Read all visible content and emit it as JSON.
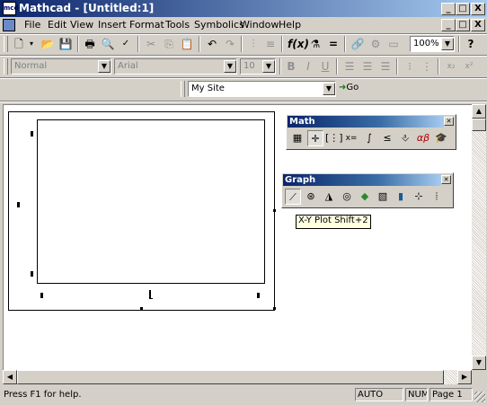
{
  "window": {
    "title": "Mathcad - [Untitled:1]"
  },
  "caption_buttons": {
    "minimize": "_",
    "maximize": "□",
    "close": "X"
  },
  "menu": [
    "File",
    "Edit",
    "View",
    "Insert",
    "Format",
    "Tools",
    "Symbolics",
    "Window",
    "Help"
  ],
  "toolbar": {
    "zoom": "100%"
  },
  "format_bar": {
    "style": "Normal",
    "font": "Arial",
    "size": "10"
  },
  "resources": {
    "site": "My Site",
    "go_label": "Go"
  },
  "math_palette": {
    "title": "Math"
  },
  "graph_palette": {
    "title": "Graph"
  },
  "tooltip": {
    "text": "X-Y Plot Shift+2"
  },
  "status": {
    "help": "Press F1 for help.",
    "auto": "AUTO",
    "num": "NUM",
    "page": "Page 1"
  },
  "icons": {
    "standard": [
      "new-icon",
      "open-icon",
      "save-icon",
      "print-icon",
      "print-preview-icon",
      "spell-check-icon",
      "cut-icon",
      "copy-icon",
      "paste-icon",
      "undo-icon",
      "redo-icon",
      "align-across-icon",
      "align-down-icon",
      "insert-function-icon",
      "insert-unit-icon",
      "calculate-icon",
      "insert-hyperlink-icon",
      "component-wizard-icon",
      "resources-icon",
      "zoom-icon",
      "help-icon"
    ],
    "format": [
      "bold-icon",
      "italic-icon",
      "underline-icon",
      "align-left-icon",
      "align-center-icon",
      "align-right-icon",
      "bullets-icon",
      "numbering-icon",
      "subscript-icon",
      "superscript-icon"
    ],
    "math": [
      "calculator-toolbar-icon",
      "graph-toolbar-icon",
      "matrix-toolbar-icon",
      "evaluation-toolbar-icon",
      "calculus-toolbar-icon",
      "boolean-toolbar-icon",
      "programming-toolbar-icon",
      "greek-toolbar-icon",
      "symbolic-toolbar-icon"
    ],
    "graph": [
      "xy-plot-icon",
      "polar-plot-icon",
      "surface-plot-icon",
      "contour-plot-icon",
      "3d-scatter-icon",
      "3d-bar-icon",
      "vector-field-icon",
      "zoom-plot-icon",
      "trace-icon"
    ]
  }
}
